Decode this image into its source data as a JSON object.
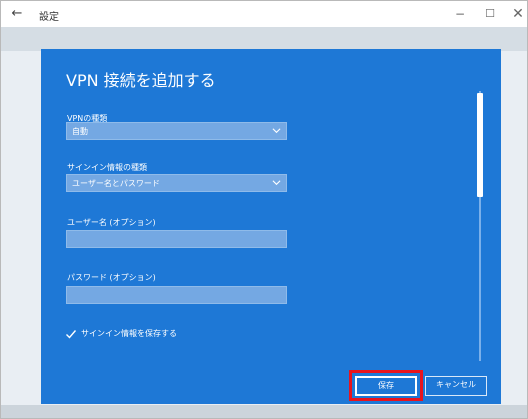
{
  "window": {
    "title": "設定",
    "back_glyph": "←",
    "minimize_glyph": "−",
    "maximize_glyph": "☐",
    "close_glyph": "✕"
  },
  "dialog": {
    "title": "VPN 接続を追加する",
    "vpn_type": {
      "label": "VPNの種類",
      "value": "自動"
    },
    "signin_type": {
      "label": "サインイン情報の種類",
      "value": "ユーザー名とパスワード"
    },
    "username": {
      "label": "ユーザー名 (オプション)",
      "value": ""
    },
    "password": {
      "label": "パスワード (オプション)",
      "value": ""
    },
    "remember": {
      "label": "サインイン情報を保存する",
      "checked": true
    },
    "save_label": "保存",
    "cancel_label": "キャンセル",
    "scrollbar": {
      "position_fraction": 0.0
    }
  },
  "colors": {
    "dialog_bg": "#1e78d6",
    "field_bg": "#74a8e3",
    "highlight": "#e8141d"
  },
  "icons": [
    "back-arrow-icon",
    "minimize-icon",
    "maximize-icon",
    "close-icon",
    "chevron-down-icon",
    "checkmark-icon"
  ]
}
